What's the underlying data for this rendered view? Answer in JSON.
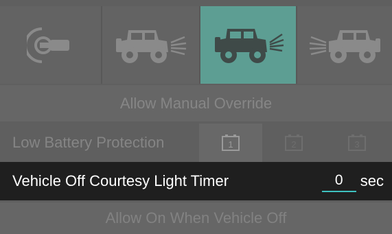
{
  "tabs": [
    {
      "icon": "ignition-key-icon",
      "active": false
    },
    {
      "icon": "vehicle-rear-lights-icon",
      "active": false
    },
    {
      "icon": "vehicle-front-lights-icon",
      "active": true
    },
    {
      "icon": "vehicle-front-lights-right-icon",
      "active": false
    }
  ],
  "override": {
    "label": "Allow Manual Override"
  },
  "battery": {
    "label": "Low Battery Protection",
    "options": [
      {
        "label": "1",
        "selected": true
      },
      {
        "label": "2",
        "selected": false
      },
      {
        "label": "3",
        "selected": false
      }
    ]
  },
  "courtesy": {
    "label": "Vehicle Off Courtesy Light Timer",
    "value": "0",
    "unit": "sec"
  },
  "allow_on": {
    "label": "Allow On When Vehicle Off"
  },
  "colors": {
    "accent": "#5d9e93",
    "underline": "#3ec2c0",
    "selected_row": "#1f1f1f",
    "background": "#5f5f5f"
  }
}
